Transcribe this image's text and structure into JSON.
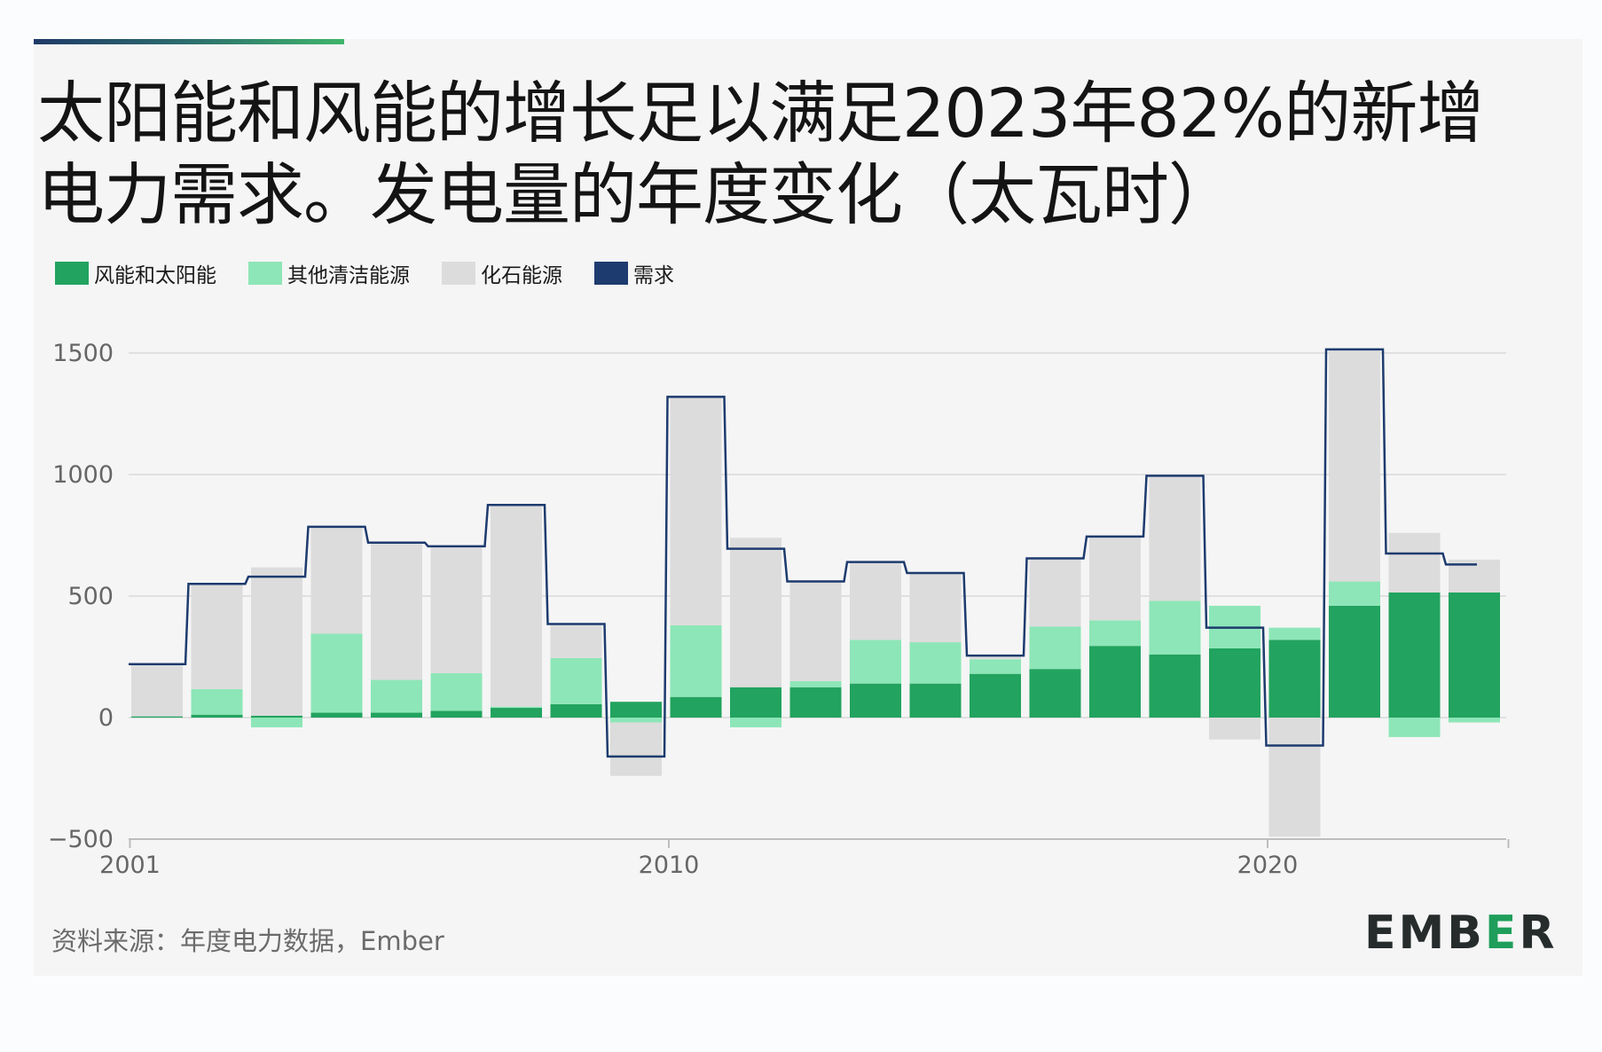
{
  "title": "太阳能和风能的增长足以满足2023年82%的新增电力需求。发电量的年度变化（太瓦时）",
  "legend": [
    {
      "label": "风能和太阳能",
      "color": "#22a35f"
    },
    {
      "label": "其他清洁能源",
      "color": "#8de6b7"
    },
    {
      "label": "化石能源",
      "color": "#dcdcdc"
    },
    {
      "label": "需求",
      "color": "#1d3b6e"
    }
  ],
  "source": "资料来源：年度电力数据，Ember",
  "logo": "EMBER",
  "chart_data": {
    "type": "bar",
    "title": "太阳能和风能的增长足以满足2023年82%的新增电力需求。发电量的年度变化（太瓦时）",
    "xlabel": "",
    "ylabel": "",
    "ylim": [
      -500,
      1500
    ],
    "yticks": [
      -500,
      0,
      500,
      1000,
      1500
    ],
    "xtick_labels": [
      "2001",
      "2010",
      "2020"
    ],
    "grid": true,
    "legend_position": "top-left",
    "stacked": true,
    "categories": [
      "2001",
      "2002",
      "2003",
      "2004",
      "2005",
      "2006",
      "2007",
      "2008",
      "2009",
      "2010",
      "2011",
      "2012",
      "2013",
      "2014",
      "2015",
      "2016",
      "2017",
      "2018",
      "2019",
      "2020",
      "2021",
      "2022",
      "2023"
    ],
    "series": [
      {
        "name": "风能和太阳能",
        "color": "#22a35f",
        "values": [
          5,
          12,
          8,
          20,
          20,
          28,
          40,
          55,
          65,
          85,
          125,
          125,
          140,
          140,
          180,
          200,
          295,
          260,
          285,
          320,
          460,
          515,
          515
        ]
      },
      {
        "name": "其他清洁能源",
        "color": "#8de6b7",
        "values": [
          0,
          105,
          -40,
          325,
          135,
          155,
          5,
          190,
          -20,
          295,
          -40,
          25,
          180,
          170,
          60,
          175,
          105,
          220,
          175,
          50,
          100,
          -80,
          -20
        ]
      },
      {
        "name": "化石能源",
        "color": "#dcdcdc",
        "values": [
          215,
          435,
          610,
          440,
          565,
          520,
          830,
          140,
          -220,
          940,
          615,
          415,
          320,
          285,
          15,
          280,
          345,
          520,
          -90,
          -490,
          960,
          245,
          135
        ]
      },
      {
        "name": "需求",
        "color": "#1d3b6e",
        "line": "step",
        "values": [
          220,
          550,
          580,
          785,
          720,
          705,
          875,
          385,
          -160,
          1320,
          695,
          560,
          640,
          595,
          255,
          655,
          745,
          995,
          370,
          -115,
          1515,
          675,
          630
        ]
      }
    ]
  }
}
